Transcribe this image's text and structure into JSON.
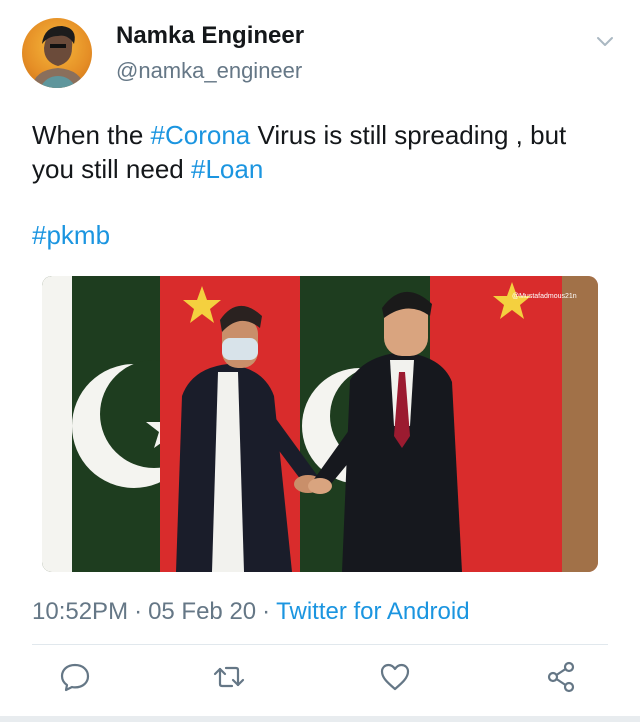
{
  "user": {
    "display_name": "Namka Engineer",
    "handle": "@namka_engineer"
  },
  "tweet": {
    "line1_prefix": "When the ",
    "line1_tag": "#Corona",
    "line1_suffix": " Virus is still spreading , but",
    "line2_prefix": "you still need ",
    "line2_tag": "#Loan",
    "hashtag": "#pkmb",
    "image_watermark": "@Mustafadmous21n"
  },
  "meta": {
    "time": "10:52PM",
    "date": "05 Feb 20",
    "separator": "·",
    "source": "Twitter for Android"
  },
  "actions": {
    "reply_icon": "reply-icon",
    "retweet_icon": "retweet-icon",
    "like_icon": "heart-icon",
    "share_icon": "share-icon"
  },
  "colors": {
    "link": "#1b95e0",
    "secondary_text": "#657786",
    "primary_text": "#14171a",
    "action_icon": "#657786"
  }
}
